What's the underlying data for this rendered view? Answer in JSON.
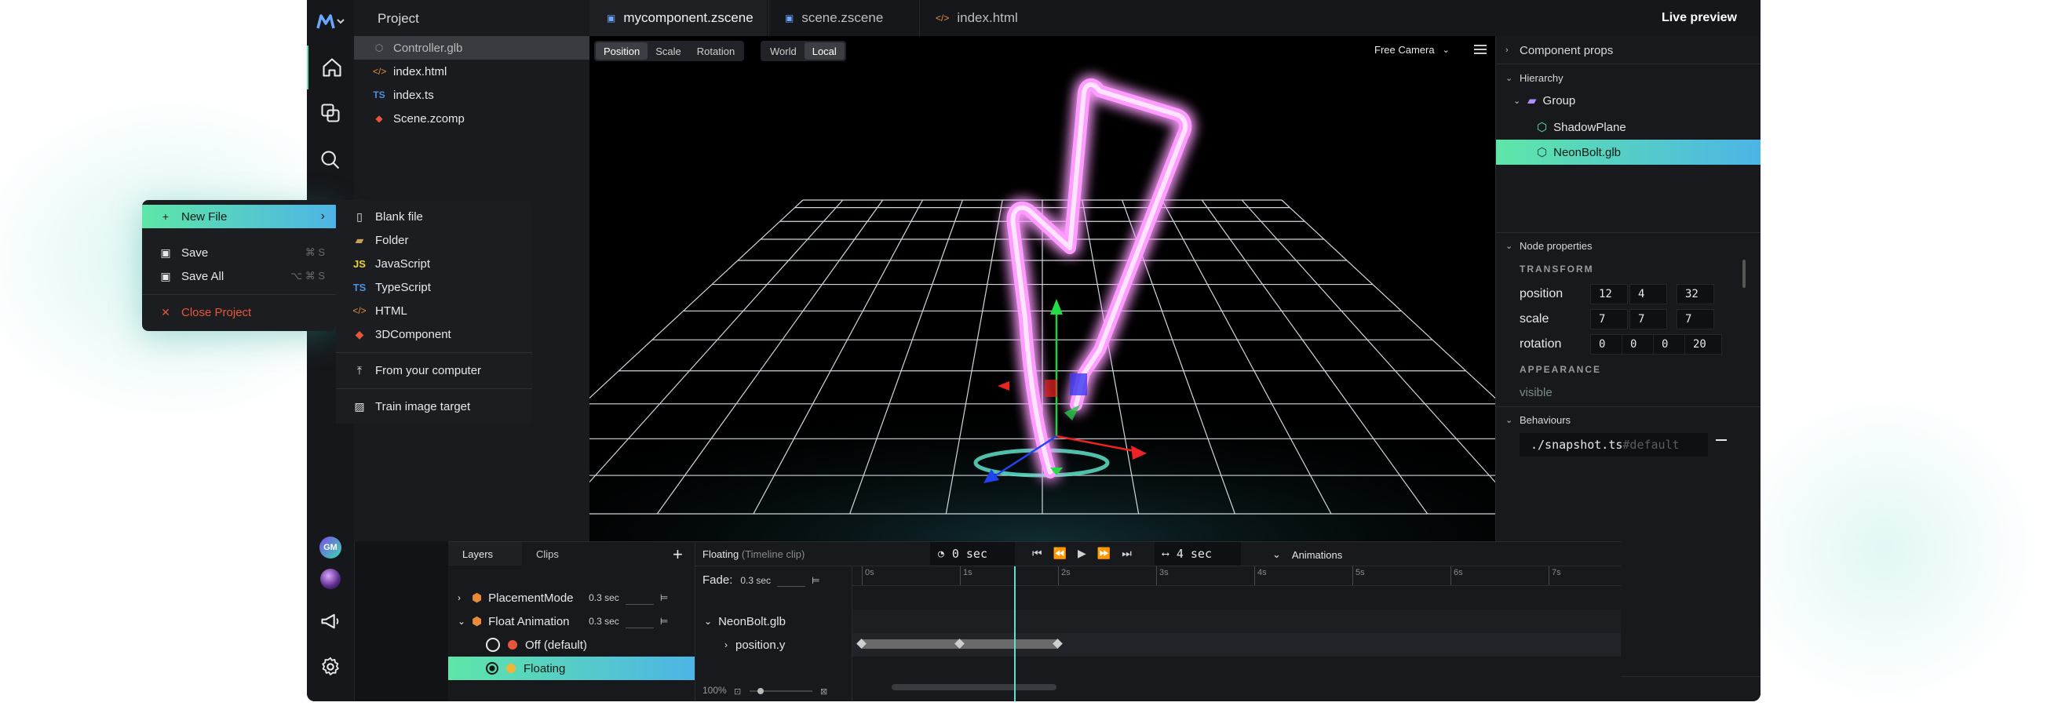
{
  "project": {
    "title": "Project",
    "files": [
      {
        "name": "Controller.glb",
        "icon": "cube-icon",
        "icon_color": "#8e8e8e"
      },
      {
        "name": "index.html",
        "icon": "code-icon",
        "icon_color": "#e8913a"
      },
      {
        "name": "index.ts",
        "icon": "ts-icon",
        "icon_color": "#4a8fe0",
        "badge": "TS"
      },
      {
        "name": "Scene.zcomp",
        "icon": "component-icon",
        "icon_color": "#e8553a"
      }
    ]
  },
  "tabs": [
    {
      "label": "mycomponent.zscene",
      "icon": "scene-icon"
    },
    {
      "label": "scene.zscene",
      "icon": "scene-icon"
    },
    {
      "label": "index.html",
      "icon": "code-icon"
    }
  ],
  "live_preview": "Live preview",
  "viewport": {
    "transform_modes": [
      "Position",
      "Scale",
      "Rotation"
    ],
    "space_modes": [
      "World",
      "Local"
    ],
    "camera": "Free Camera"
  },
  "right_panel": {
    "component_props": "Component props",
    "hierarchy": "Hierarchy",
    "nodes": [
      "Group",
      "ShadowPlane",
      "NeonBolt.glb"
    ],
    "node_properties": "Node properties",
    "transform_label": "TRANSFORM",
    "position_label": "position",
    "position": [
      "12",
      "4",
      "32"
    ],
    "scale_label": "scale",
    "scale": [
      "7",
      "7",
      "7"
    ],
    "rotation_label": "rotation",
    "rotation": [
      "0",
      "0",
      "0",
      "20"
    ],
    "appearance_label": "APPEARANCE",
    "visible_label": "visible",
    "behaviours": "Behaviours",
    "behaviour_path": "./snapshot.ts",
    "behaviour_suffix": "#default"
  },
  "rail": {
    "avatar_initials": "GM"
  },
  "menu": {
    "new_file": "New File",
    "save": "Save",
    "save_shortcut": "⌘ S",
    "save_all": "Save All",
    "save_all_shortcut": "⌥ ⌘ S",
    "close_project": "Close Project",
    "accent": "#e8553a"
  },
  "submenu": {
    "items": [
      {
        "label": "Blank file",
        "icon": "file-icon"
      },
      {
        "label": "Folder",
        "icon": "folder-icon"
      },
      {
        "label": "JavaScript",
        "icon": "js-icon",
        "badge": "JS"
      },
      {
        "label": "TypeScript",
        "icon": "ts-icon",
        "badge": "TS"
      },
      {
        "label": "HTML",
        "icon": "code-icon"
      },
      {
        "label": "3DComponent",
        "icon": "component-icon"
      }
    ],
    "from_computer": "From your computer",
    "train_target": "Train image target"
  },
  "timeline": {
    "layers_tab": "Layers",
    "clips_tab": "Clips",
    "clip_title": "Floating",
    "clip_subtitle": "(Timeline clip)",
    "time_current": "0 sec",
    "time_total": "4 sec",
    "animations": "Animations",
    "fade_label": "Fade:",
    "fade_value": "0.3 sec",
    "layers": [
      {
        "name": "PlacementMode",
        "duration": "0.3 sec"
      },
      {
        "name": "Float Animation",
        "duration": "0.3 sec"
      },
      {
        "name": "Off (default)"
      },
      {
        "name": "Floating"
      }
    ],
    "track_node": "NeonBolt.glb",
    "track_prop": "position.y",
    "ruler": [
      "0s",
      "1s",
      "2s",
      "3s",
      "4s",
      "5s",
      "6s",
      "7s"
    ],
    "zoom": "100%",
    "playhead_time": 1.55,
    "keyframes": [
      0,
      1,
      2
    ]
  },
  "colors": {
    "accent_green": "#5ee6a8",
    "accent_blue": "#4db4e6",
    "neon": "#ff9cff"
  }
}
